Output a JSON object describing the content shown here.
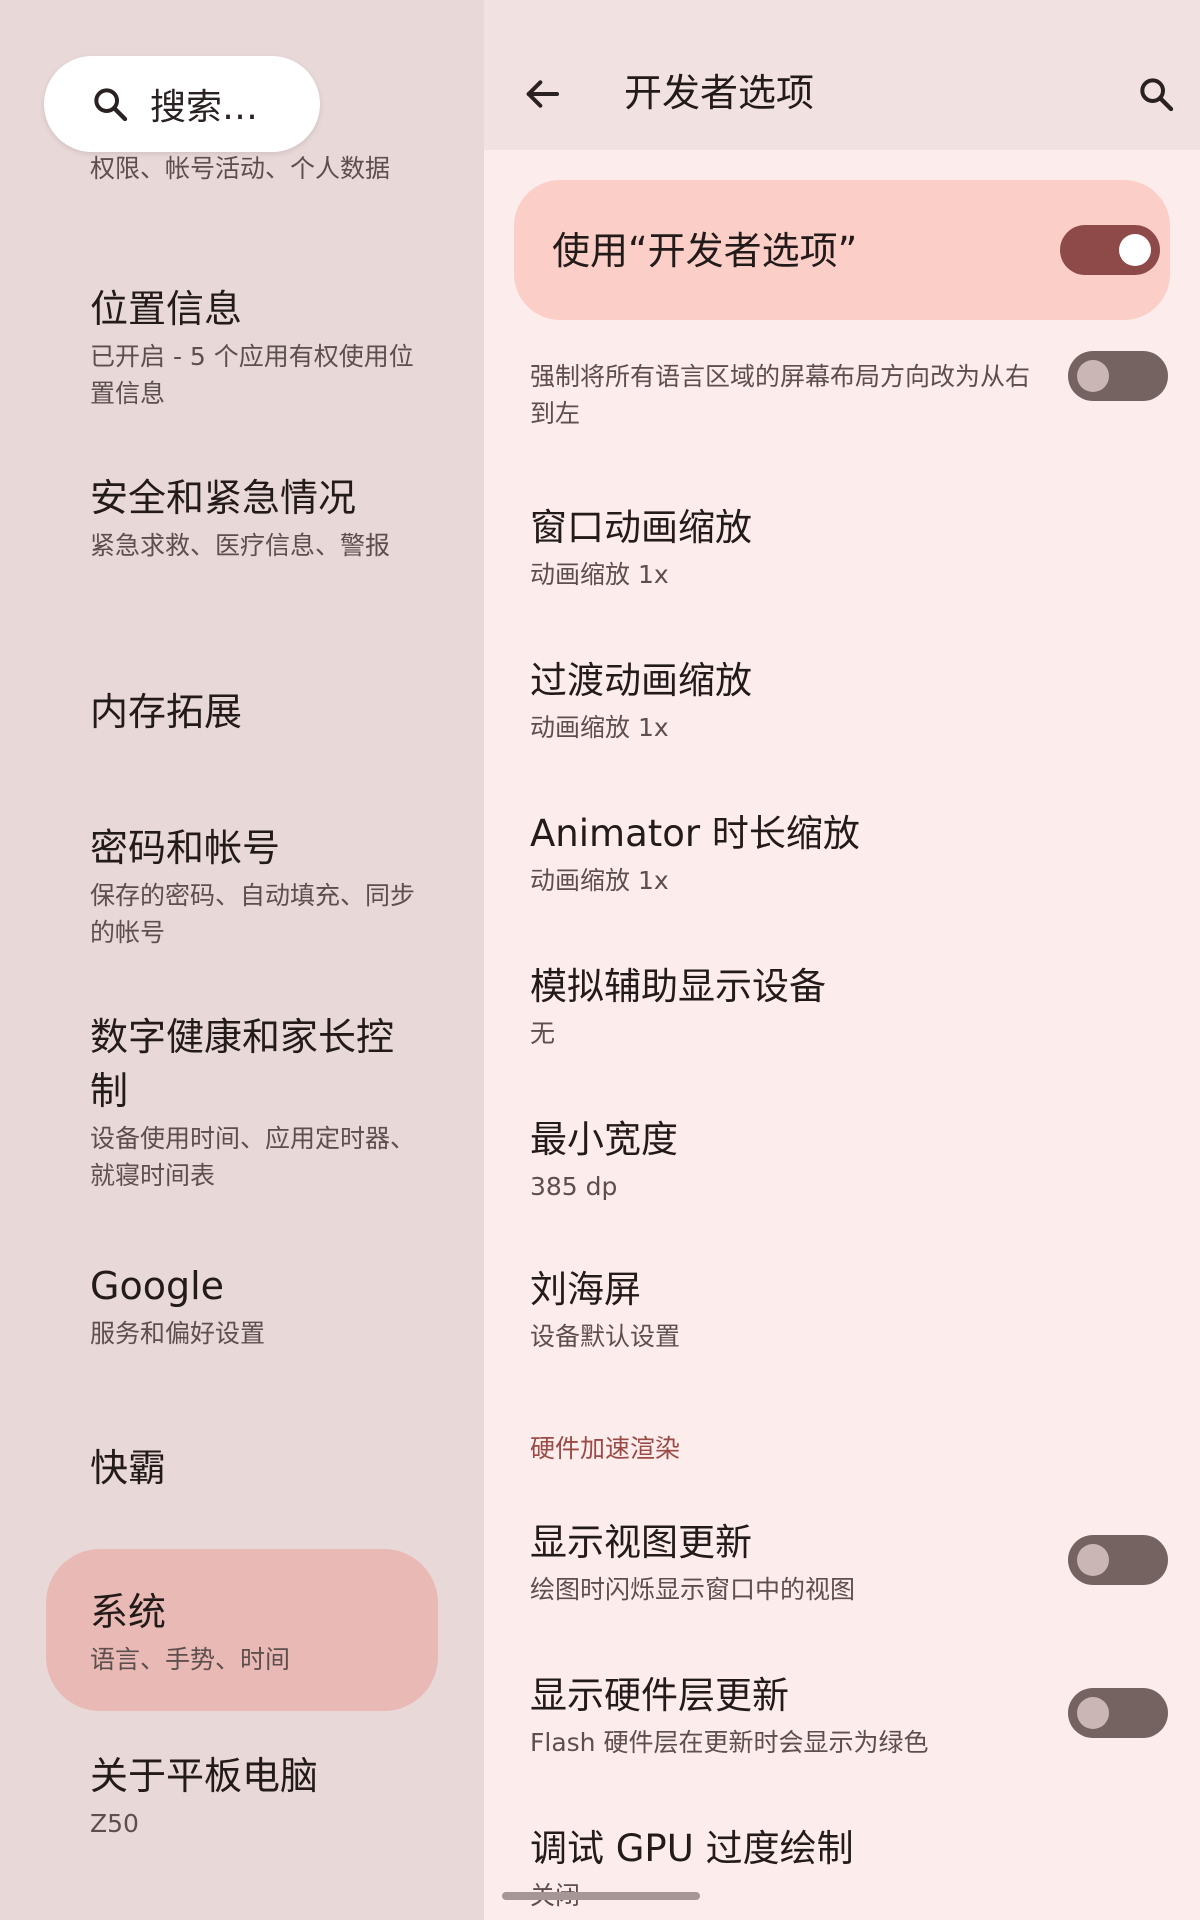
{
  "settings_nav": {
    "search_placeholder": "搜索…",
    "clipped_item_sub": "权限、帐号活动、个人数据",
    "items": [
      {
        "title": "位置信息",
        "subtitle": "已开启 - 5 个应用有权使用位置信息"
      },
      {
        "title": "安全和紧急情况",
        "subtitle": "紧急求救、医疗信息、警报"
      },
      {
        "title": "内存拓展",
        "subtitle": ""
      },
      {
        "title": "密码和帐号",
        "subtitle": "保存的密码、自动填充、同步的帐号"
      },
      {
        "title": "数字健康和家长控制",
        "subtitle": "设备使用时间、应用定时器、就寝时间表"
      },
      {
        "title": "Google",
        "subtitle": "服务和偏好设置"
      },
      {
        "title": "快霸",
        "subtitle": ""
      },
      {
        "title": "系统",
        "subtitle": "语言、手势、时间",
        "selected": true
      },
      {
        "title": "关于平板电脑",
        "subtitle": "Z50"
      }
    ]
  },
  "developer_options": {
    "page_title": "开发者选项",
    "master_toggle": {
      "label": "使用“开发者选项”",
      "enabled": true
    },
    "clipped_item": {
      "subtitle": "强制将所有语言区域的屏幕布局方向改为从右到左",
      "enabled": false
    },
    "items": [
      {
        "title": "窗口动画缩放",
        "subtitle": "动画缩放 1x"
      },
      {
        "title": "过渡动画缩放",
        "subtitle": "动画缩放 1x"
      },
      {
        "title": "Animator 时长缩放",
        "subtitle": "动画缩放 1x"
      },
      {
        "title": "模拟辅助显示设备",
        "subtitle": "无"
      },
      {
        "title": "最小宽度",
        "subtitle": "385 dp"
      },
      {
        "title": "刘海屏",
        "subtitle": "设备默认设置"
      }
    ],
    "section_header": "硬件加速渲染",
    "hw_items": [
      {
        "title": "显示视图更新",
        "subtitle": "绘图时闪烁显示窗口中的视图",
        "enabled": false
      },
      {
        "title": "显示硬件层更新",
        "subtitle": "Flash 硬件层在更新时会显示为绿色",
        "enabled": false
      },
      {
        "title": "调试 GPU 过度绘制",
        "subtitle": "关闭"
      }
    ]
  },
  "icons": {
    "search": "search-icon",
    "back": "arrow-back-icon"
  },
  "colors": {
    "left_background": "#e8d8d7",
    "right_background": "#fcecec",
    "selected_item": "#e9bab5",
    "master_card": "#fbcfc8",
    "toggle_on": "#8e4a48",
    "toggle_off": "#756362",
    "section_header": "#9a4b46"
  }
}
